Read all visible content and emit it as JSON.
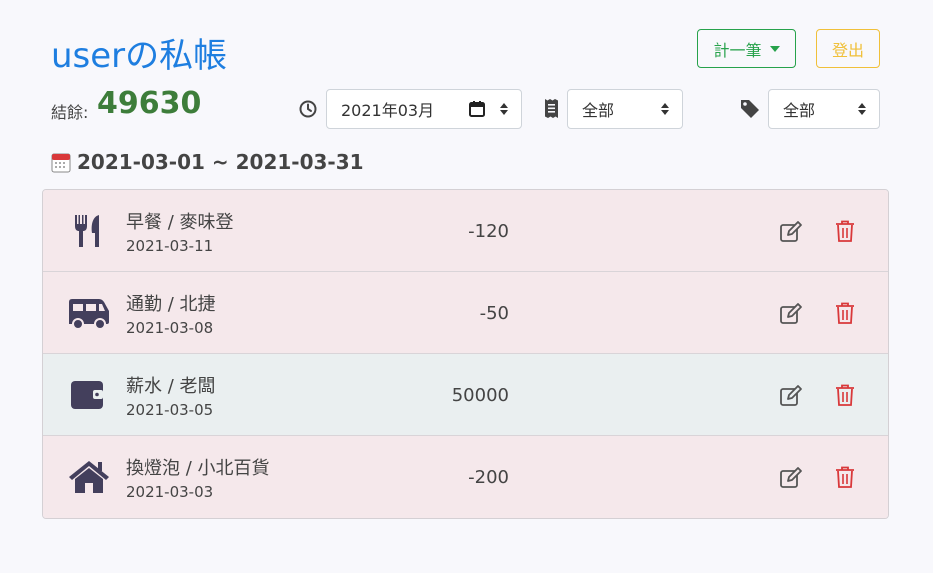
{
  "header": {
    "title": "userの私帳",
    "add_button": "計一筆",
    "logout_button": "登出"
  },
  "balance": {
    "label": "結餘:",
    "value": "49630"
  },
  "filters": {
    "month": "2021年03月",
    "type": "全部",
    "tag": "全部"
  },
  "date_range": "2021-03-01 ~ 2021-03-31",
  "records": [
    {
      "icon": "utensils-icon",
      "name": "早餐 / 麥味登",
      "date": "2021-03-11",
      "amount": "-120",
      "kind": "expense"
    },
    {
      "icon": "van-icon",
      "name": "通勤 / 北捷",
      "date": "2021-03-08",
      "amount": "-50",
      "kind": "expense"
    },
    {
      "icon": "wallet-icon",
      "name": "薪水 / 老闆",
      "date": "2021-03-05",
      "amount": "50000",
      "kind": "income"
    },
    {
      "icon": "home-icon",
      "name": "換燈泡 / 小北百貨",
      "date": "2021-03-03",
      "amount": "-200",
      "kind": "expense"
    }
  ],
  "colors": {
    "brand": "#1e7ee0",
    "balance": "#3d7d3a",
    "add": "#27a24b",
    "logout": "#f0c03a",
    "delete": "#d9383a",
    "expense_row": "#f5e8eb",
    "income_row": "#eaeff0"
  }
}
